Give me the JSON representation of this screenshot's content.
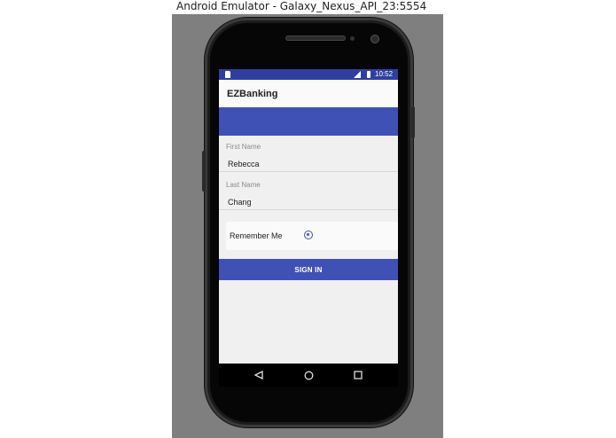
{
  "window": {
    "title": "Android Emulator - Galaxy_Nexus_API_23:5554"
  },
  "status_bar": {
    "time": "10:52",
    "icons": [
      "sd-card-icon",
      "signal-icon",
      "battery-icon"
    ]
  },
  "app_bar": {
    "title": "EZBanking"
  },
  "form": {
    "first_name": {
      "label": "First Name",
      "value": "Rebecca"
    },
    "last_name": {
      "label": "Last Name",
      "value": "Chang"
    },
    "remember_me": {
      "label": "Remember Me",
      "selected": true
    },
    "sign_in_label": "SIGN IN"
  },
  "nav_bar": {
    "buttons": [
      "back-icon",
      "home-icon",
      "recents-icon"
    ]
  },
  "colors": {
    "primary": "#3f51b5",
    "primary_dark": "#303f9f",
    "background": "#f0f0f0",
    "emulator_bg": "#7f7f7f"
  }
}
